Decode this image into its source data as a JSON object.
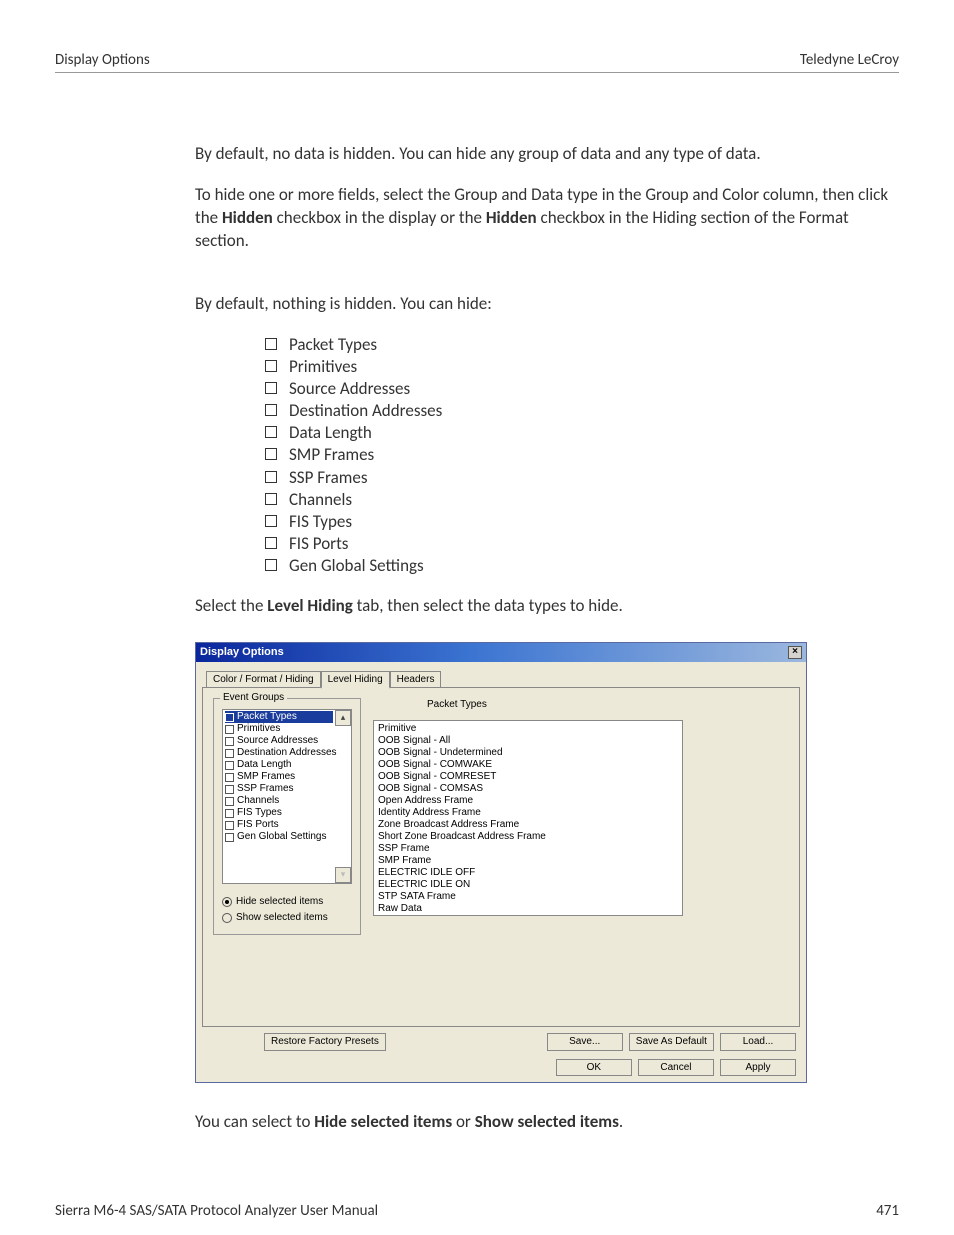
{
  "header": {
    "left": "Display Options",
    "right": "Teledyne LeCroy"
  },
  "paras": {
    "p1": "By default, no data is hidden. You can hide any group of data and any type of data.",
    "p2_a": "To hide one or more fields, select the Group and Data type in the Group and Color column, then click the ",
    "p2_bold1": "Hidden",
    "p2_b": " checkbox in the display or the ",
    "p2_bold2": "Hidden",
    "p2_c": " checkbox in the Hiding section of the Format section.",
    "p3": "By default, nothing is hidden. You can hide:",
    "p4_a": "Select the ",
    "p4_bold": "Level Hiding",
    "p4_b": " tab, then select the data types to hide.",
    "p5_a": "You can select to ",
    "p5_bold1": "Hide selected items",
    "p5_b": " or ",
    "p5_bold2": "Show selected items",
    "p5_c": "."
  },
  "hide_list": [
    "Packet Types",
    "Primitives",
    "Source Addresses",
    "Destination Addresses",
    "Data Length",
    "SMP Frames",
    "SSP Frames",
    "Channels",
    "FIS Types",
    "FIS Ports",
    "Gen Global Settings"
  ],
  "dialog": {
    "title": "Display Options",
    "tabs": [
      "Color / Format / Hiding",
      "Level Hiding",
      "Headers"
    ],
    "group_label": "Event Groups",
    "event_groups": [
      "Packet Types",
      "Primitives",
      "Source Addresses",
      "Destination Addresses",
      "Data Length",
      "SMP Frames",
      "SSP Frames",
      "Channels",
      "FIS Types",
      "FIS Ports",
      "Gen Global Settings"
    ],
    "radio_hide": "Hide selected items",
    "radio_show": "Show selected items",
    "right_title": "Packet Types",
    "details": [
      "Primitive",
      "OOB Signal - All",
      "OOB Signal - Undetermined",
      "OOB Signal - COMWAKE",
      "OOB Signal - COMRESET",
      "OOB Signal - COMSAS",
      "Open Address Frame",
      "Identity Address Frame",
      "Zone Broadcast Address Frame",
      "Short Zone Broadcast Address Frame",
      "SSP Frame",
      "SMP Frame",
      "ELECTRIC IDLE OFF",
      "ELECTRIC IDLE ON",
      "STP SATA Frame",
      "Raw Data"
    ],
    "buttons": {
      "restore": "Restore Factory Presets",
      "save": "Save...",
      "save_default": "Save As Default",
      "load": "Load...",
      "ok": "OK",
      "cancel": "Cancel",
      "apply": "Apply"
    }
  },
  "footer": {
    "left": "Sierra M6-4 SAS/SATA Protocol Analyzer User Manual",
    "right": "471"
  }
}
